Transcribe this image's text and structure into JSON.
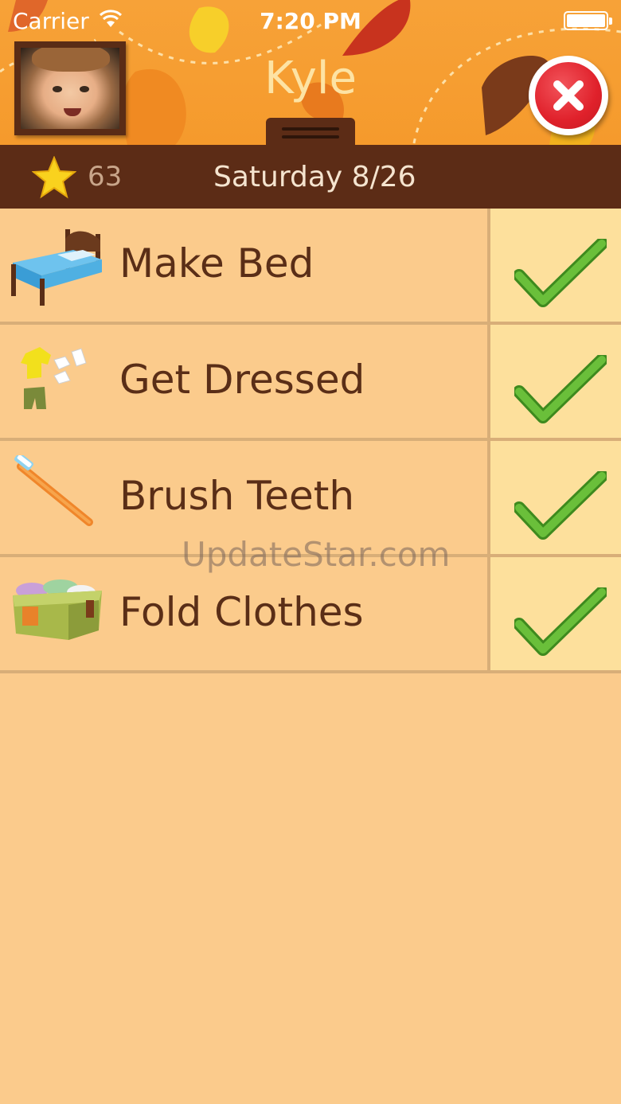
{
  "status_bar": {
    "carrier": "Carrier",
    "time": "7:20 PM"
  },
  "header": {
    "child_name": "Kyle",
    "avatar_icon": "child-photo",
    "close_icon": "close-x-icon"
  },
  "info_bar": {
    "star_count": "63",
    "date": "Saturday 8/26"
  },
  "chores": [
    {
      "label": "Make Bed",
      "icon": "bed-icon",
      "completed": true
    },
    {
      "label": "Get Dressed",
      "icon": "clothes-icon",
      "completed": true
    },
    {
      "label": "Brush Teeth",
      "icon": "toothbrush-icon",
      "completed": true
    },
    {
      "label": "Fold Clothes",
      "icon": "laundry-basket-icon",
      "completed": true
    }
  ],
  "watermark": "UpdateStar.com",
  "colors": {
    "header_orange": "#f59a2c",
    "info_bar_brown": "#5c2c16",
    "list_background": "#fbcb8c",
    "check_cell": "#fde09c",
    "check_green": "#6abf3a",
    "close_red": "#e0212b"
  }
}
